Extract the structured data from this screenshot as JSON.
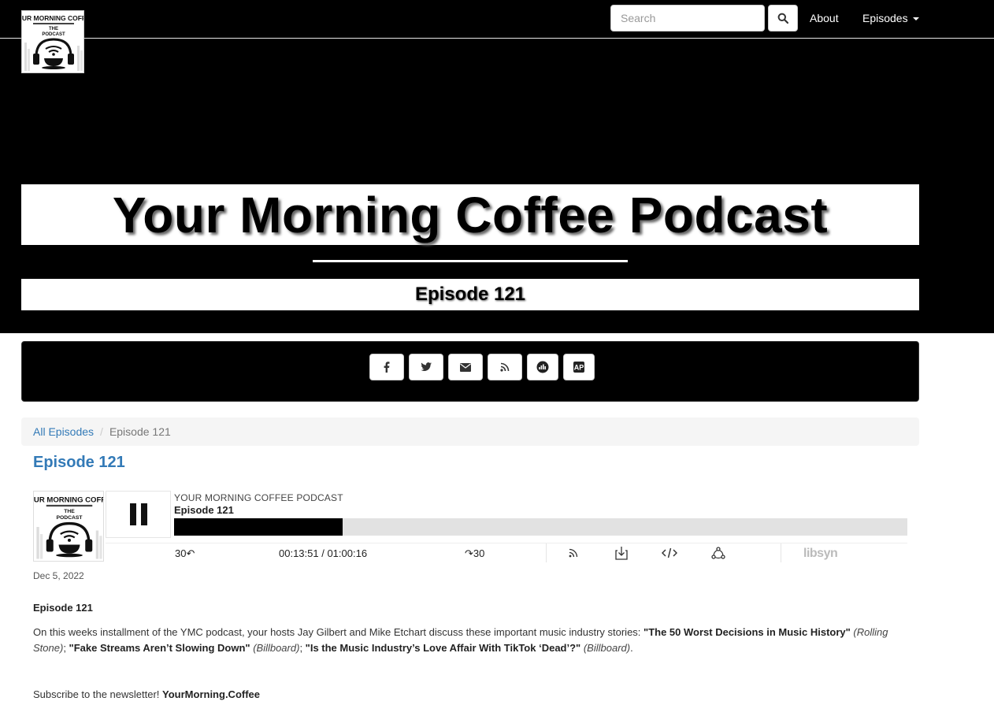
{
  "brand": {
    "logo_lines": [
      "YOUR MORNING COFFEE",
      "THE",
      "PODCAST"
    ]
  },
  "nav": {
    "search_placeholder": "Search",
    "about_label": "About",
    "episodes_label": "Episodes"
  },
  "hero": {
    "title": "Your Morning Coffee Podcast",
    "subtitle": "Episode 121"
  },
  "share": {
    "buttons": [
      "facebook-icon",
      "twitter-icon",
      "email-icon",
      "rss-icon",
      "deezer-icon",
      "apple-podcasts-icon"
    ]
  },
  "breadcrumb": {
    "all_episodes": "All Episodes",
    "current": "Episode 121"
  },
  "episode": {
    "heading": "Episode 121",
    "date": "Dec 5, 2022"
  },
  "player": {
    "podcast_name": "YOUR MORNING COFFEE PODCAST",
    "episode_title": "Episode 121",
    "skip_back_label": "30",
    "skip_forward_label": "30",
    "time_display": "00:13:51 / 01:00:16",
    "progress_fraction": 0.23,
    "brand": "libsyn"
  },
  "description": {
    "title": "Episode 121",
    "intro": "On this weeks installment of the YMC podcast, your hosts Jay Gilbert and Mike Etchart discuss these important music industry stories: ",
    "story1": "\"The 50 Worst Decisions in Music History\"",
    "source1": "(Rolling Stone)",
    "sep1": "; ",
    "story2": "\"Fake Streams Aren’t Slowing Down\"",
    "source2": "(Billboard)",
    "sep2": "; ",
    "story3": "\"Is the Music Industry’s Love Affair With TikTok ‘Dead’?\"",
    "source3": "(Billboard)",
    "end": ".",
    "newsletter_text": "Subscribe to the newsletter! ",
    "newsletter_link": "YourMorning.Coffee"
  }
}
